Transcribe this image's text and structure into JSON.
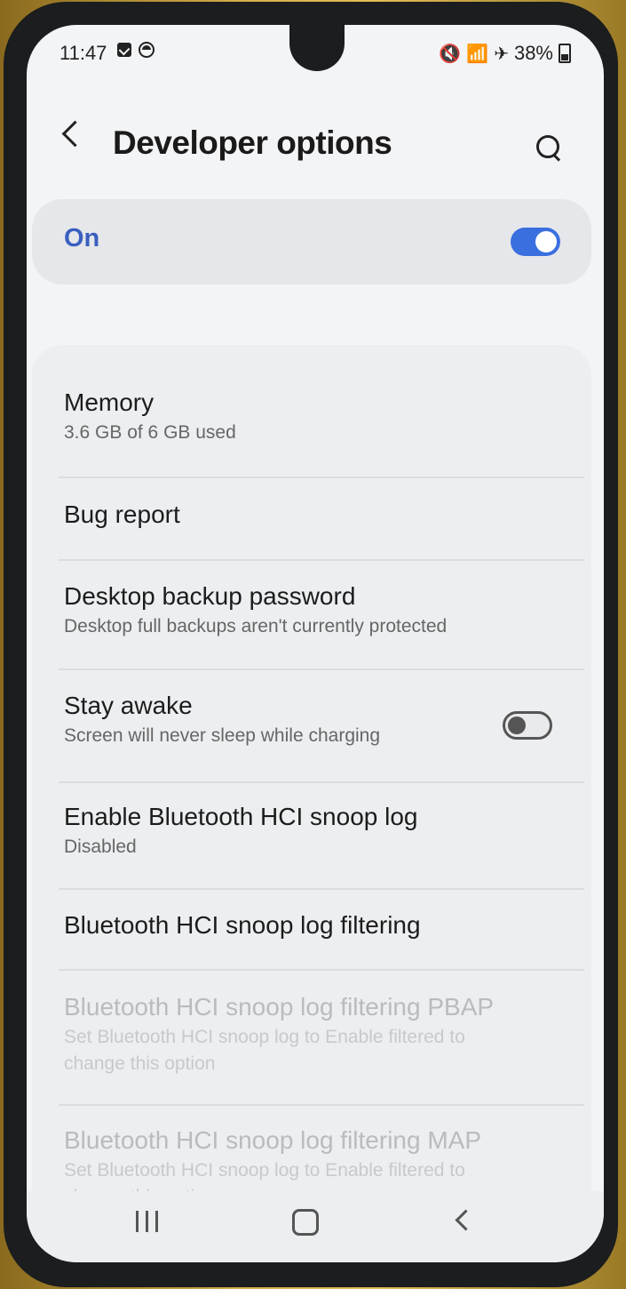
{
  "status_bar": {
    "time": "11:47",
    "battery_text": "38%",
    "icons": [
      "notification-check-icon",
      "circle-notification-icon",
      "mute-icon",
      "wifi-icon",
      "airplane-icon",
      "battery-icon"
    ]
  },
  "header": {
    "title": "Developer options",
    "back_icon": "back-chevron-icon",
    "search_icon": "search-icon"
  },
  "master_switch": {
    "label": "On",
    "state": "on",
    "accent_color": "#3a6fe0",
    "label_color": "#3a5fc0"
  },
  "settings": [
    {
      "title": "Memory",
      "subtitle": "3.6 GB of 6 GB used",
      "enabled": true
    },
    {
      "title": "Bug report",
      "subtitle": "",
      "enabled": true
    },
    {
      "title": "Desktop backup password",
      "subtitle": "Desktop full backups aren't currently protected",
      "enabled": true
    },
    {
      "title": "Stay awake",
      "subtitle": "Screen will never sleep while charging",
      "enabled": true,
      "toggle": "off"
    },
    {
      "title": "Enable Bluetooth HCI snoop log",
      "subtitle": "Disabled",
      "enabled": true
    },
    {
      "title": "Bluetooth HCI snoop log filtering",
      "subtitle": "",
      "enabled": true
    },
    {
      "title": "Bluetooth HCI snoop log filtering PBAP",
      "subtitle_line1": "Set Bluetooth HCI snoop log to Enable filtered to",
      "subtitle_line2": "change this option",
      "enabled": false
    },
    {
      "title": "Bluetooth HCI snoop log filtering MAP",
      "subtitle_line1": "Set Bluetooth HCI snoop log to Enable filtered to",
      "subtitle_line2": "change this option",
      "enabled": false
    }
  ],
  "nav_bar": {
    "icons": [
      "recent-apps-icon",
      "home-icon",
      "back-icon"
    ]
  }
}
